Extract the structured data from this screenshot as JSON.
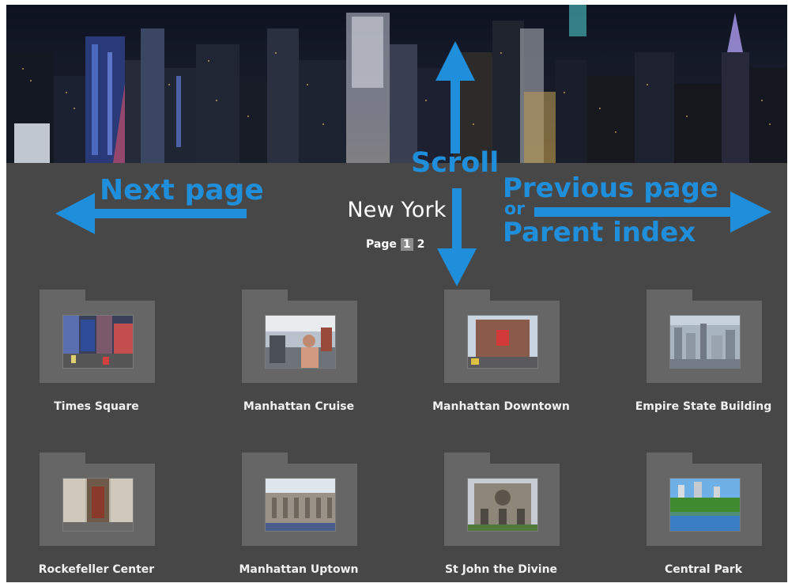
{
  "gallery": {
    "title": "New York",
    "pager": {
      "label": "Page",
      "current": "1",
      "next": "2"
    }
  },
  "annotations": {
    "next_page": "Next page",
    "scroll": "Scroll",
    "previous_page": "Previous page",
    "or": "or",
    "parent_index": "Parent index",
    "color": "#1f8fdc"
  },
  "albums": [
    {
      "label": "Times Square"
    },
    {
      "label": "Manhattan Cruise"
    },
    {
      "label": "Manhattan Downtown"
    },
    {
      "label": "Empire State Building"
    },
    {
      "label": "Rockefeller Center"
    },
    {
      "label": "Manhattan Uptown"
    },
    {
      "label": "St John the Divine"
    },
    {
      "label": "Central Park"
    }
  ],
  "colors": {
    "background": "#474747",
    "folder": "#666666",
    "text": "#ffffff"
  }
}
